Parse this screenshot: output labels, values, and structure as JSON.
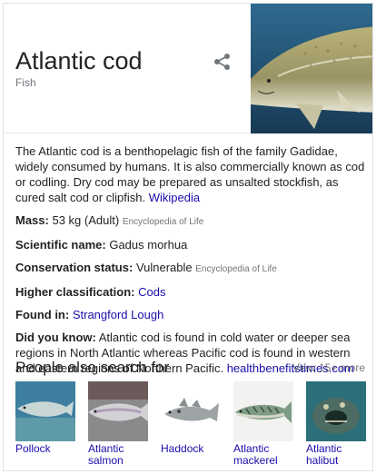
{
  "header": {
    "title": "Atlantic cod",
    "subtitle": "Fish",
    "share_icon": "share-icon"
  },
  "description": {
    "text": "The Atlantic cod is a benthopelagic fish of the family Gadidae, widely consumed by humans. It is also commercially known as cod or codling. Dry cod may be prepared as unsalted stockfish, as cured salt cod or clipfish.",
    "source": "Wikipedia"
  },
  "facts": {
    "mass_label": "Mass:",
    "mass_value": "53 kg (Adult)",
    "mass_source": "Encyclopedia of Life",
    "scientific_label": "Scientific name:",
    "scientific_value": "Gadus morhua",
    "conservation_label": "Conservation status:",
    "conservation_value": "Vulnerable",
    "conservation_source": "Encyclopedia of Life",
    "classification_label": "Higher classification:",
    "classification_value": "Cods",
    "found_label": "Found in:",
    "found_value": "Strangford Lough",
    "dyk_label": "Did you know:",
    "dyk_value": "Atlantic cod is found in cold water or deeper sea regions in North Atlantic whereas Pacific cod is found in western and eastern regions of Northern Pacific.",
    "dyk_source": "healthbenefitstimes.com"
  },
  "people_also_search": {
    "title": "People also search for",
    "view_more": "View 15+ more",
    "items": [
      {
        "label": "Pollock"
      },
      {
        "label": "Atlantic salmon"
      },
      {
        "label": "Haddock"
      },
      {
        "label": "Atlantic mackerel"
      },
      {
        "label": "Atlantic halibut"
      }
    ]
  },
  "colors": {
    "link": "#1a0dab",
    "muted": "#70757a",
    "text": "#222222",
    "border": "#dfe1e5"
  }
}
